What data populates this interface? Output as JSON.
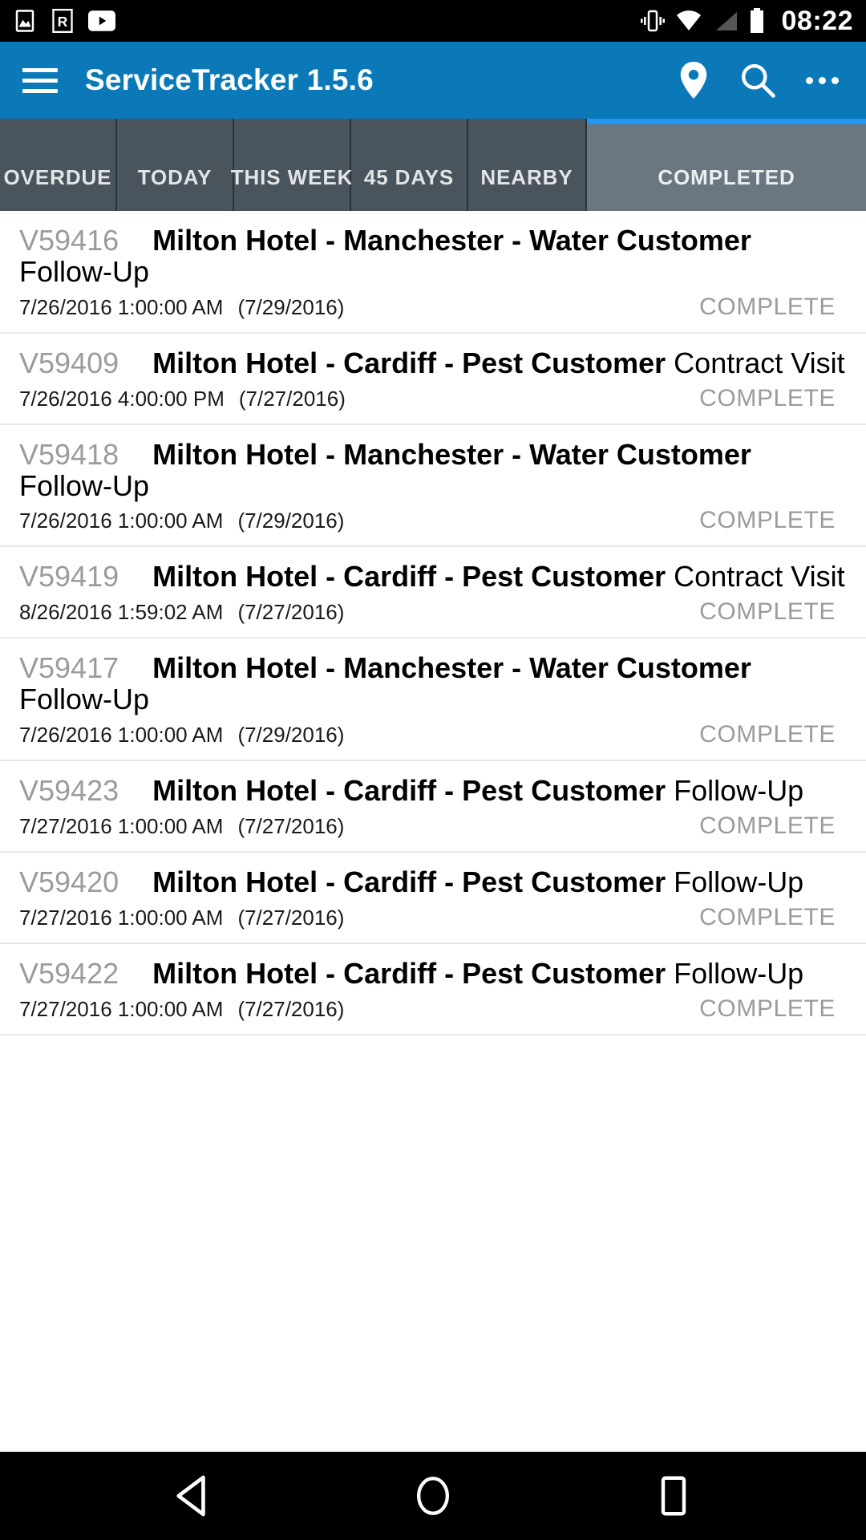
{
  "statusbar": {
    "time": "08:22",
    "left_icons": [
      "image-icon",
      "r-badge-icon",
      "youtube-icon"
    ],
    "right_icons": [
      "vibrate-icon",
      "wifi-icon",
      "signal-icon",
      "battery-icon"
    ]
  },
  "appbar": {
    "menu_icon": "hamburger-menu-icon",
    "title": "ServiceTracker 1.5.6",
    "actions": [
      {
        "name": "location-pin-icon",
        "label": "Location"
      },
      {
        "name": "search-icon",
        "label": "Search"
      },
      {
        "name": "overflow-menu-icon",
        "label": "More options"
      }
    ],
    "background_color": "#0b79b8"
  },
  "tabs": {
    "active_index": 5,
    "indicator_color": "#2196f3",
    "items": [
      {
        "label": "OVERDUE"
      },
      {
        "label": "TODAY"
      },
      {
        "label": "THIS WEEK"
      },
      {
        "label": "45 DAYS"
      },
      {
        "label": "NEARBY"
      },
      {
        "label": "COMPLETED"
      }
    ]
  },
  "list": {
    "rows": [
      {
        "job_id": "V59416",
        "customer": "Milton Hotel - Manchester - Water Customer",
        "visit_type": "Follow-Up",
        "datetime": "7/26/2016 1:00:00 AM",
        "due_date": "(7/29/2016)",
        "status": "COMPLETE"
      },
      {
        "job_id": "V59409",
        "customer": "Milton Hotel - Cardiff - Pest Customer",
        "visit_type": "Contract Visit",
        "datetime": "7/26/2016 4:00:00 PM",
        "due_date": "(7/27/2016)",
        "status": "COMPLETE"
      },
      {
        "job_id": "V59418",
        "customer": "Milton Hotel - Manchester - Water Customer",
        "visit_type": "Follow-Up",
        "datetime": "7/26/2016 1:00:00 AM",
        "due_date": "(7/29/2016)",
        "status": "COMPLETE"
      },
      {
        "job_id": "V59419",
        "customer": "Milton Hotel - Cardiff - Pest Customer",
        "visit_type": "Contract Visit",
        "datetime": "8/26/2016 1:59:02 AM",
        "due_date": "(7/27/2016)",
        "status": "COMPLETE"
      },
      {
        "job_id": "V59417",
        "customer": "Milton Hotel - Manchester - Water Customer",
        "visit_type": "Follow-Up",
        "datetime": "7/26/2016 1:00:00 AM",
        "due_date": "(7/29/2016)",
        "status": "COMPLETE"
      },
      {
        "job_id": "V59423",
        "customer": "Milton Hotel - Cardiff - Pest Customer",
        "visit_type": "Follow-Up",
        "datetime": "7/27/2016 1:00:00 AM",
        "due_date": "(7/27/2016)",
        "status": "COMPLETE"
      },
      {
        "job_id": "V59420",
        "customer": "Milton Hotel - Cardiff - Pest Customer",
        "visit_type": "Follow-Up",
        "datetime": "7/27/2016 1:00:00 AM",
        "due_date": "(7/27/2016)",
        "status": "COMPLETE"
      },
      {
        "job_id": "V59422",
        "customer": "Milton Hotel - Cardiff - Pest Customer",
        "visit_type": "Follow-Up",
        "datetime": "7/27/2016 1:00:00 AM",
        "due_date": "(7/27/2016)",
        "status": "COMPLETE"
      }
    ]
  },
  "navbar": {
    "buttons": [
      {
        "name": "back-nav-icon",
        "label": "Back"
      },
      {
        "name": "home-nav-icon",
        "label": "Home"
      },
      {
        "name": "recents-nav-icon",
        "label": "Recents"
      }
    ]
  }
}
